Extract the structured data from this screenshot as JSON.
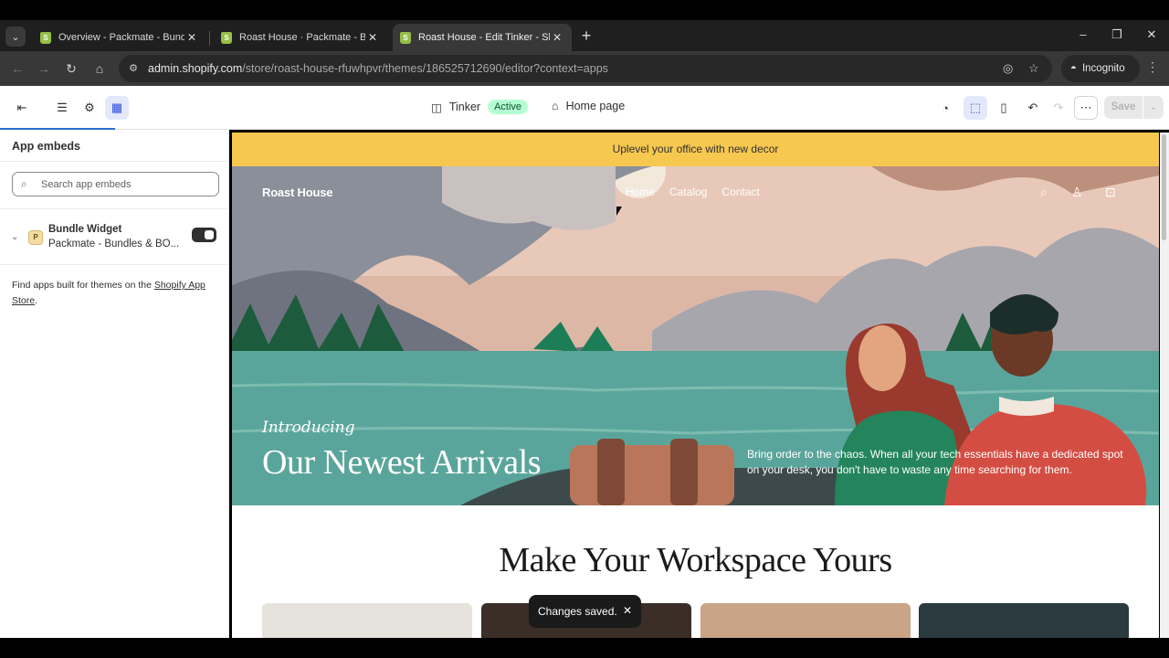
{
  "browser": {
    "tabs": [
      {
        "title": "Overview - Packmate - Bundles",
        "active": false
      },
      {
        "title": "Roast House · Packmate - Bund",
        "active": false
      },
      {
        "title": "Roast House - Edit Tinker - Shop",
        "active": true
      }
    ],
    "url_host": "admin.shopify.com",
    "url_path": "/store/roast-house-rfuwhpvr/themes/186525712690/editor?context=apps",
    "incognito_label": "Incognito"
  },
  "editor": {
    "theme_name": "Tinker",
    "theme_status": "Active",
    "page_name": "Home page",
    "save_label": "Save"
  },
  "sidebar": {
    "title": "App embeds",
    "search_placeholder": "Search app embeds",
    "embed": {
      "name": "Bundle Widget",
      "subtitle": "Packmate - Bundles & BO...",
      "enabled": true
    },
    "find_text": "Find apps built for themes on the ",
    "find_link": "Shopify App Store",
    "find_end": "."
  },
  "preview": {
    "announcement": "Uplevel your office with new decor",
    "brand": "Roast House",
    "nav": [
      "Home",
      "Catalog",
      "Contact"
    ],
    "intro": "Introducing",
    "headline": "Our Newest Arrivals",
    "description": "Bring order to the chaos. When all your tech essentials have a dedicated spot on your desk, you don't have to waste any time searching for them.",
    "section_title": "Make Your Workspace Yours"
  },
  "toast": {
    "message": "Changes saved."
  },
  "colors": {
    "announcement_bg": "#f7c850",
    "active_badge": "#b4fed2",
    "selected_tool": "#e3e8fb"
  }
}
